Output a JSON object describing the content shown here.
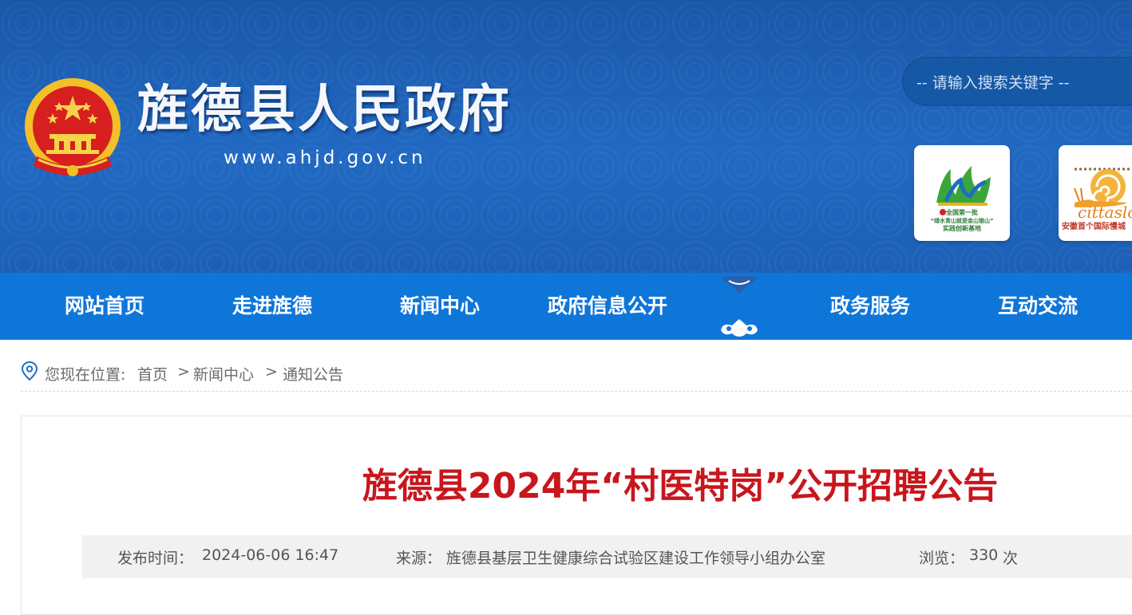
{
  "header": {
    "site_title": "旌德县人民政府",
    "site_url": "www.ahjd.gov.cn",
    "search_placeholder": "-- 请输入搜索关键字 --",
    "badges": [
      {
        "caption_lines": [
          "全国第一批",
          "“绿水青山就是金山银山”",
          "实践创新基地"
        ],
        "icon": "mountain-logo-icon"
      },
      {
        "word": "cittaslow",
        "caption": "安徽首个国际慢城",
        "icon": "snail-logo-icon"
      }
    ]
  },
  "nav": {
    "items": [
      "网站首页",
      "走进旌德",
      "新闻中心",
      "政府信息公开",
      "政务服务",
      "互动交流"
    ]
  },
  "breadcrumb": {
    "prefix": "您现在位置:",
    "items": [
      "首页",
      "新闻中心",
      "通知公告"
    ],
    "separator": ">"
  },
  "article": {
    "title": "旌德县2024年“村医特岗”公开招聘公告",
    "publish_time_label": "发布时间：",
    "publish_time": "2024-06-06 16:47",
    "source_label": "来源：",
    "source": "旌德县基层卫生健康综合试验区建设工作领导小组办公室",
    "views_label": "浏览：",
    "views": "330",
    "views_unit": "次"
  },
  "colors": {
    "header_blue": "#1d62b8",
    "nav_blue": "#0f76d9",
    "title_red": "#c8161d",
    "emblem_gold": "#f2c029",
    "emblem_red": "#d71f1f"
  }
}
